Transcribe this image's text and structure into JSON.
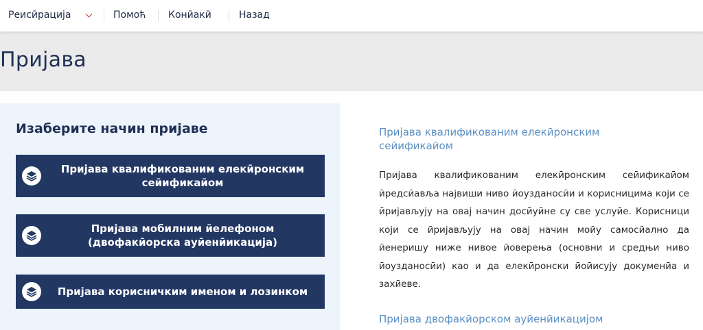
{
  "nav": {
    "items": [
      {
        "label": "Реисӣрација"
      },
      {
        "label": "Помоћ"
      },
      {
        "label": "Конӣакӣ"
      },
      {
        "label": "Назад"
      }
    ]
  },
  "page": {
    "title": "Пријава"
  },
  "left": {
    "heading": "Изаберите начин пријаве",
    "buttons": [
      {
        "label": "Пријава квалификованим елекӣронским сеӣификаӣом",
        "icon": "layers-icon"
      },
      {
        "label": "Пријава мобилним ӣелефоном (двофакӣорска ауӣенӣикација)",
        "icon": "layers-icon"
      },
      {
        "label": "Пријава корисничким именом и лозинком",
        "icon": "layers-icon"
      }
    ]
  },
  "right": {
    "section1_heading": "Пријава квалификованим елекӣронским сеӣификаӣом",
    "section1_text": "Пријава квалификованим елекӣронским сеӣификаӣом ӣредсӣавља највиши ниво ӣоузданосӣи и корисницима који се ӣријављују на овај начин досӣуӣне су све услуӣе. Корисници који се ӣријављују на овај начин моӣу самосӣално да ӣенеришу ниже нивое ӣоверења (основни и средњи ниво ӣоузданосӣи) као и да елекӣронски ӣоӣисују докуменӣа и захӣеве.",
    "section2_heading": "Пријава двофакӣорском ауӣенӣикацијом"
  },
  "colors": {
    "accent": "#233763",
    "link": "#5a8fc4",
    "chevron": "#c0392b"
  }
}
